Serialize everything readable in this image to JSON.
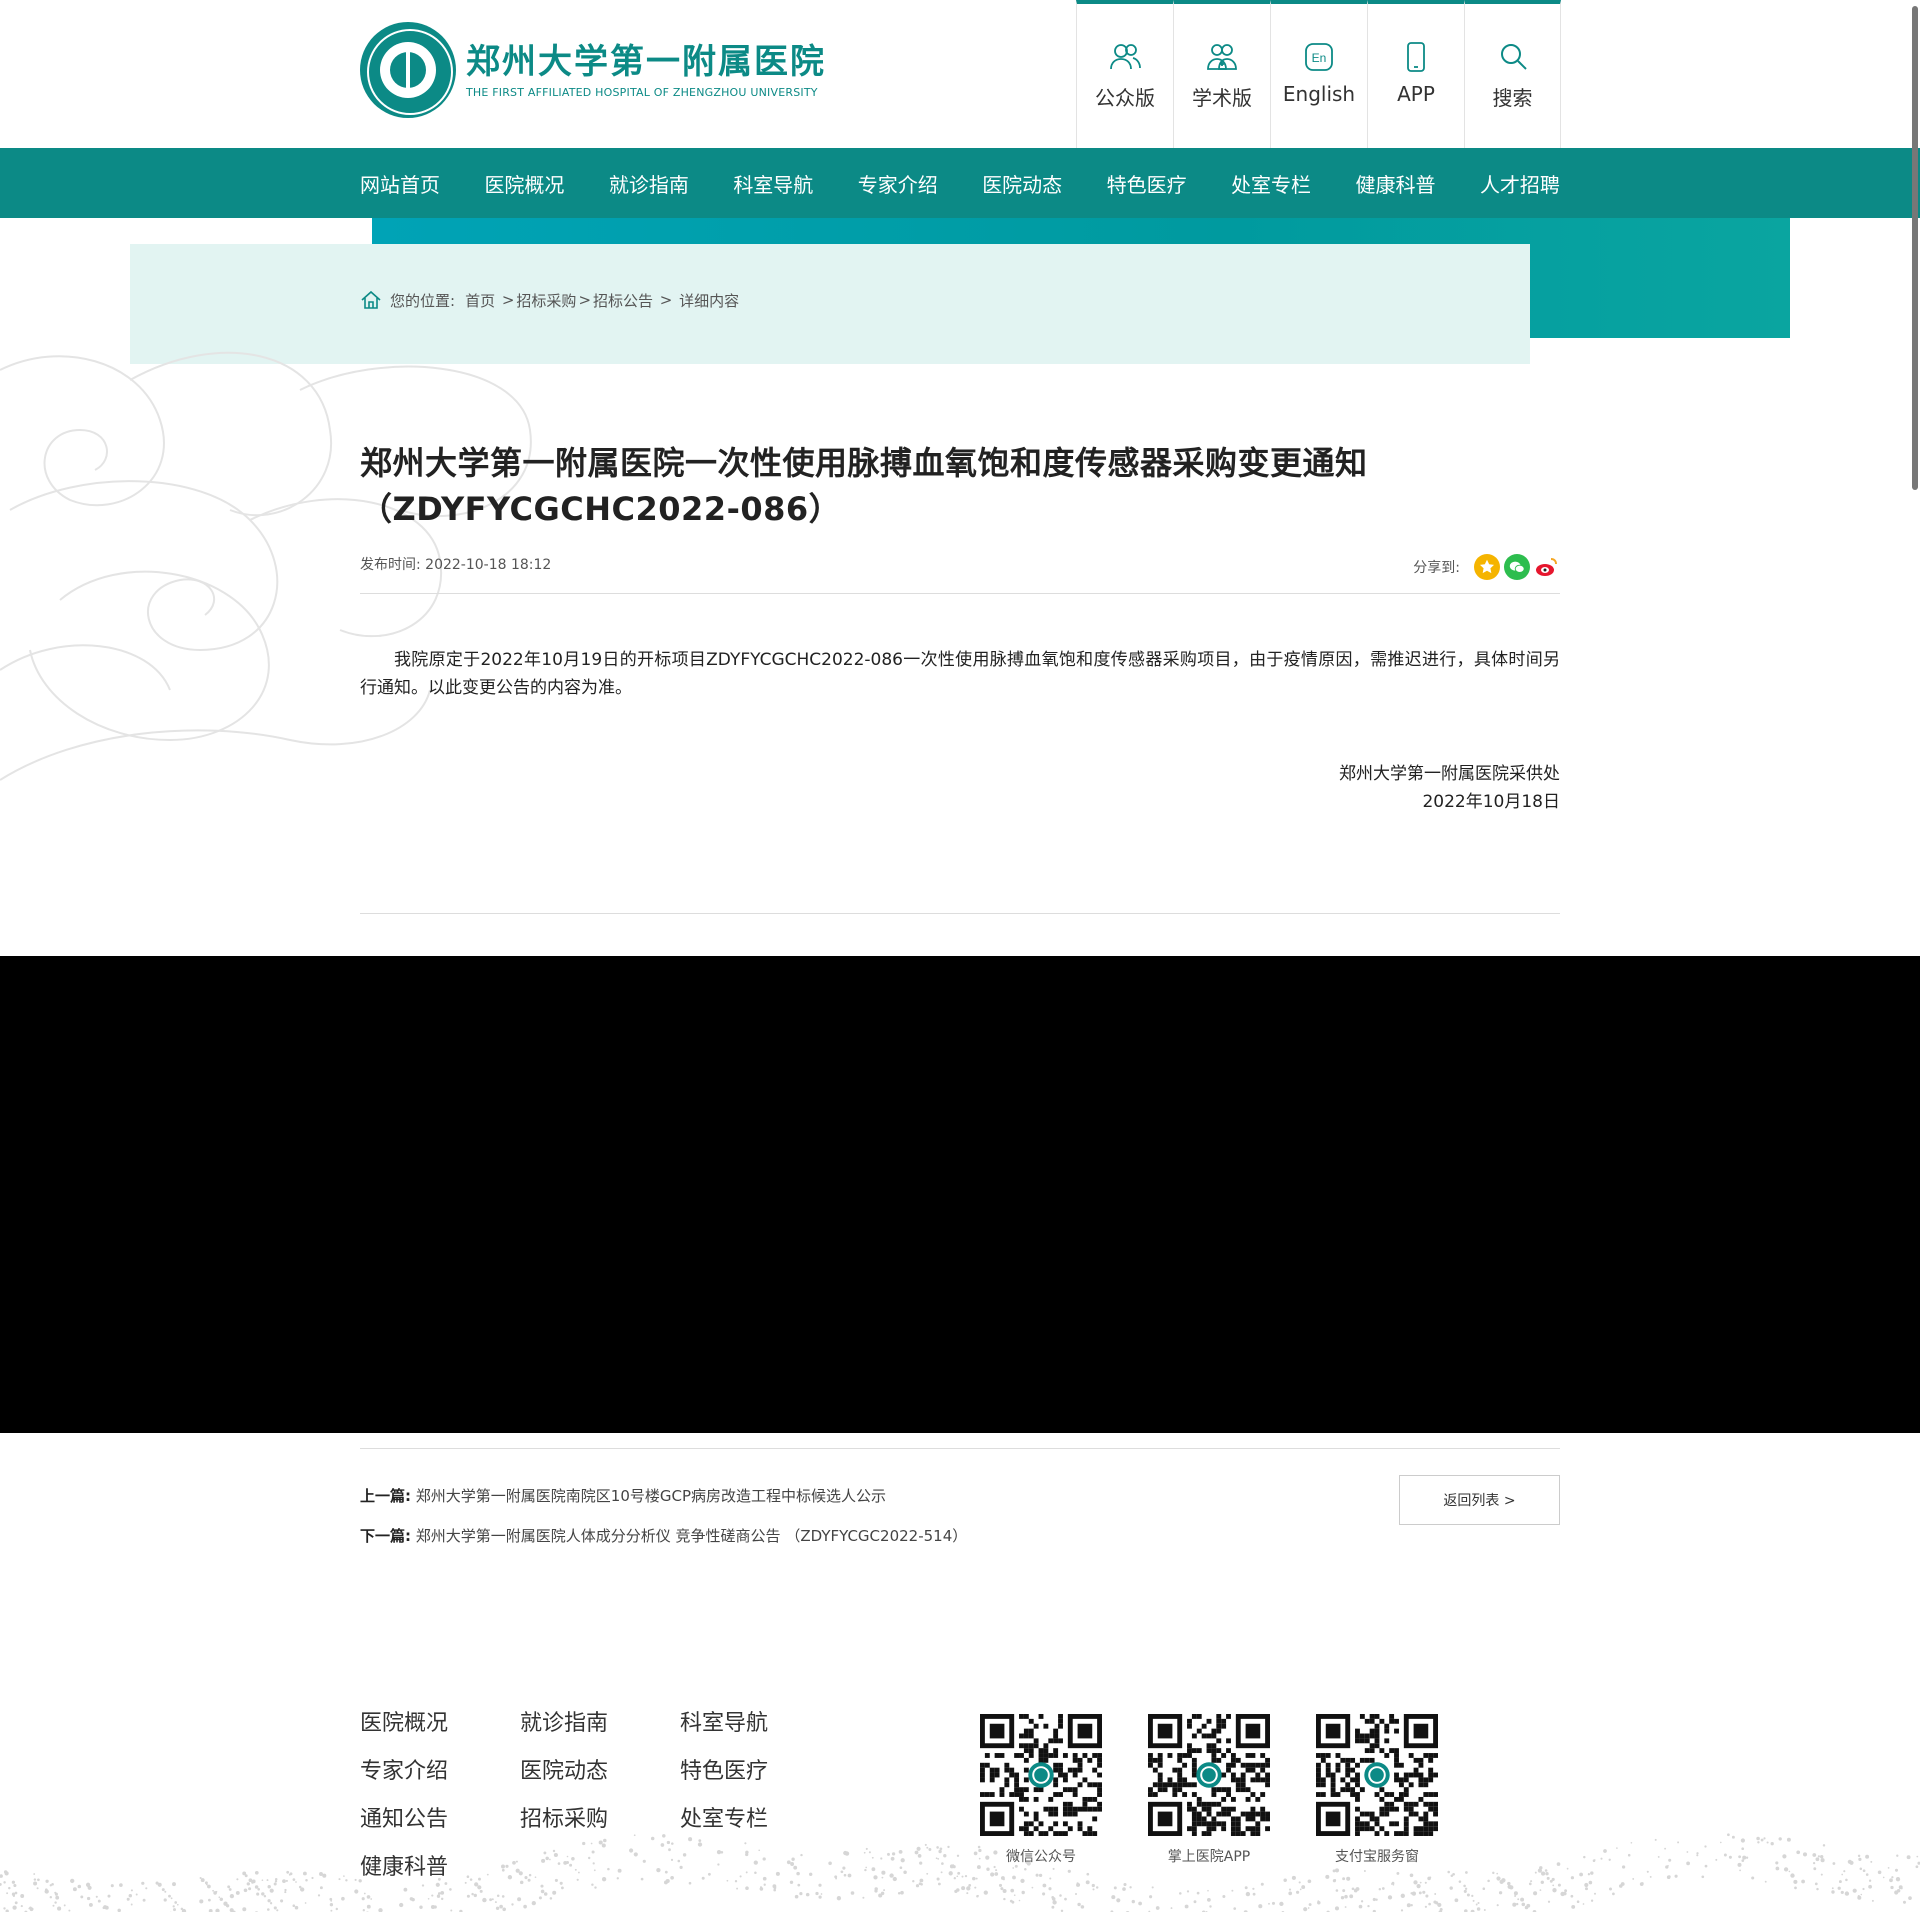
{
  "header": {
    "logo_cn": "郑州大学第一附属医院",
    "logo_en": "THE FIRST AFFILIATED HOSPITAL OF ZHENGZHOU UNIVERSITY",
    "quick_links": [
      {
        "label": "公众版",
        "icon": "users-icon"
      },
      {
        "label": "学术版",
        "icon": "doctors-icon"
      },
      {
        "label": "English",
        "icon": "en-icon"
      },
      {
        "label": "APP",
        "icon": "phone-icon"
      },
      {
        "label": "搜索",
        "icon": "search-icon"
      }
    ]
  },
  "nav": {
    "items": [
      "网站首页",
      "医院概况",
      "就诊指南",
      "科室导航",
      "专家介绍",
      "医院动态",
      "特色医疗",
      "处室专栏",
      "健康科普",
      "人才招聘"
    ]
  },
  "breadcrumb": {
    "prefix": "您的位置:",
    "items": [
      "首页",
      "招标采购",
      "招标公告",
      "详细内容"
    ]
  },
  "article": {
    "title": "郑州大学第一附属医院一次性使用脉搏血氧饱和度传感器采购变更通知（ZDYFYCGCHC2022-086）",
    "publish_label": "发布时间:",
    "publish_time": "2022-10-18 18:12",
    "share_label": "分享到:",
    "body": "我院原定于2022年10月19日的开标项目ZDYFYCGCHC2022-086一次性使用脉搏血氧饱和度传感器采购项目，由于疫情原因，需推迟进行，具体时间另行通知。以此变更公告的内容为准。",
    "sign_org": "郑州大学第一附属医院采供处",
    "sign_date": "2022年10月18日"
  },
  "pager": {
    "prev_label": "上一篇:",
    "prev_title": "郑州大学第一附属医院南院区10号楼GCP病房改造工程中标候选人公示",
    "next_label": "下一篇:",
    "next_title": "郑州大学第一附属医院人体成分分析仪 竞争性磋商公告 （ZDYFYCGC2022-514）",
    "back_label": "返回列表 >"
  },
  "footer": {
    "links": [
      "医院概况",
      "就诊指南",
      "科室导航",
      "专家介绍",
      "医院动态",
      "特色医疗",
      "通知公告",
      "招标采购",
      "处室专栏",
      "健康科普"
    ],
    "qrs": [
      "微信公众号",
      "掌上医院APP",
      "支付宝服务窗"
    ]
  },
  "colors": {
    "brand": "#0c8a86",
    "nav_bg": "#0c8a86",
    "crumb_bg": "#e2f4f2"
  }
}
